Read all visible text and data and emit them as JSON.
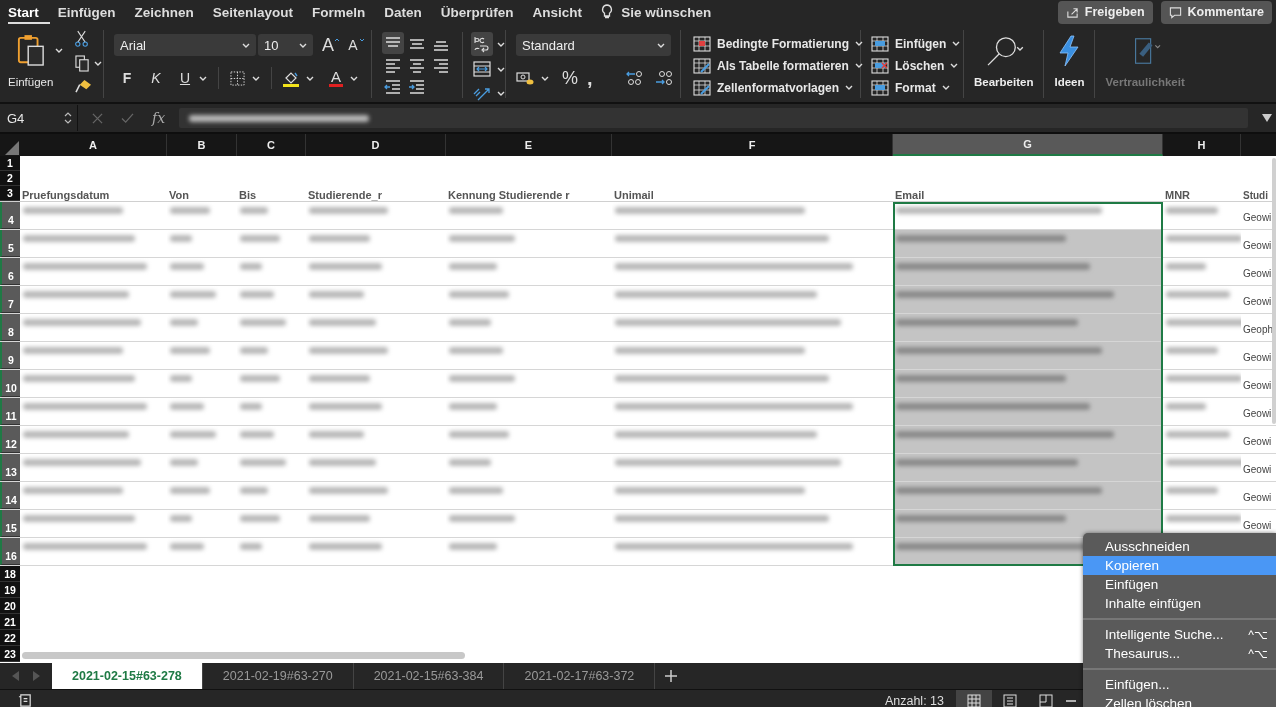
{
  "menu_tabs": [
    {
      "label": "Start",
      "selected": true
    },
    {
      "label": "Einfügen",
      "selected": false
    },
    {
      "label": "Zeichnen",
      "selected": false
    },
    {
      "label": "Seitenlayout",
      "selected": false
    },
    {
      "label": "Formeln",
      "selected": false
    },
    {
      "label": "Daten",
      "selected": false
    },
    {
      "label": "Überprüfen",
      "selected": false
    },
    {
      "label": "Ansicht",
      "selected": false
    }
  ],
  "tell_me": "Sie wünschen",
  "share_buttons": [
    "Freigeben",
    "Kommentare"
  ],
  "ribbon": {
    "paste_label": "Einfügen",
    "font": "Arial",
    "font_size": "10",
    "grow_glyph": "A",
    "shrink_glyph": "A",
    "bold": "F",
    "italic": "K",
    "underline": "U",
    "font_color_glyph": "A",
    "number_format": "Standard",
    "percent": "%",
    "comma": ",",
    "styles": [
      "Bedingte Formatierung",
      "Als Tabelle formatieren",
      "Zellenformatvorlagen"
    ],
    "cells": [
      "Einfügen",
      "Löschen",
      "Format"
    ],
    "editing": "Bearbeiten",
    "ideas": "Ideen",
    "sensitivity": {
      "label": "Vertraulichkeit",
      "disabled": true
    }
  },
  "formula_bar": {
    "name_box": "G4",
    "fx": "fx"
  },
  "sheet": {
    "columns": [
      {
        "letter": "A",
        "selected": false
      },
      {
        "letter": "B",
        "selected": false
      },
      {
        "letter": "C",
        "selected": false
      },
      {
        "letter": "D",
        "selected": false
      },
      {
        "letter": "E",
        "selected": false
      },
      {
        "letter": "F",
        "selected": false
      },
      {
        "letter": "G",
        "selected": true
      },
      {
        "letter": "H",
        "selected": false
      }
    ],
    "top_rows": [
      "1",
      "2",
      "3"
    ],
    "header_row": [
      "Pruefungsdatum",
      "Von",
      "Bis",
      "Studierende_r",
      "Kennung Studierende r",
      "Unimail",
      "Email",
      "MNR",
      "Studi"
    ],
    "data_rows": [
      {
        "number": "4",
        "active": true,
        "col_i": "Geowi"
      },
      {
        "number": "5",
        "active": false,
        "col_i": "Geowi"
      },
      {
        "number": "6",
        "active": false,
        "col_i": "Geowi"
      },
      {
        "number": "7",
        "active": false,
        "col_i": "Geowi"
      },
      {
        "number": "8",
        "active": false,
        "col_i": "Geoph"
      },
      {
        "number": "9",
        "active": false,
        "col_i": "Geowi"
      },
      {
        "number": "10",
        "active": false,
        "col_i": "Geowi"
      },
      {
        "number": "11",
        "active": false,
        "col_i": "Geowi"
      },
      {
        "number": "12",
        "active": false,
        "col_i": "Geowi"
      },
      {
        "number": "13",
        "active": false,
        "col_i": "Geowi"
      },
      {
        "number": "14",
        "active": false,
        "col_i": "Geowi"
      },
      {
        "number": "15",
        "active": false,
        "col_i": "Geowi"
      },
      {
        "number": "16",
        "active": false
      }
    ],
    "bottom_rows": [
      "18",
      "19",
      "20",
      "21",
      "22",
      "23"
    ]
  },
  "sheet_tabs": [
    {
      "label": "2021-02-15#63-278",
      "selected": true
    },
    {
      "label": "2021-02-19#63-270",
      "selected": false
    },
    {
      "label": "2021-02-15#63-384",
      "selected": false
    },
    {
      "label": "2021-02-17#63-372",
      "selected": false
    }
  ],
  "status_bar": {
    "count": "Anzahl: 13",
    "views": [
      {
        "kind": "normal",
        "selected": true
      },
      {
        "kind": "page-layout",
        "selected": false
      },
      {
        "kind": "page-break",
        "selected": false
      }
    ]
  },
  "context_menu": [
    [
      {
        "label": "Ausschneiden",
        "selected": false
      },
      {
        "label": "Kopieren",
        "selected": true
      },
      {
        "label": "Einfügen",
        "selected": false
      },
      {
        "label": "Inhalte einfügen",
        "selected": false
      }
    ],
    [
      {
        "label": "Intelligente Suche...",
        "shortcut": "^⌥",
        "selected": false
      },
      {
        "label": "Thesaurus...",
        "shortcut": "^⌥",
        "selected": false
      }
    ],
    [
      {
        "label": "Einfügen...",
        "selected": false
      },
      {
        "label": "Zellen löschen",
        "selected": false
      }
    ]
  ]
}
